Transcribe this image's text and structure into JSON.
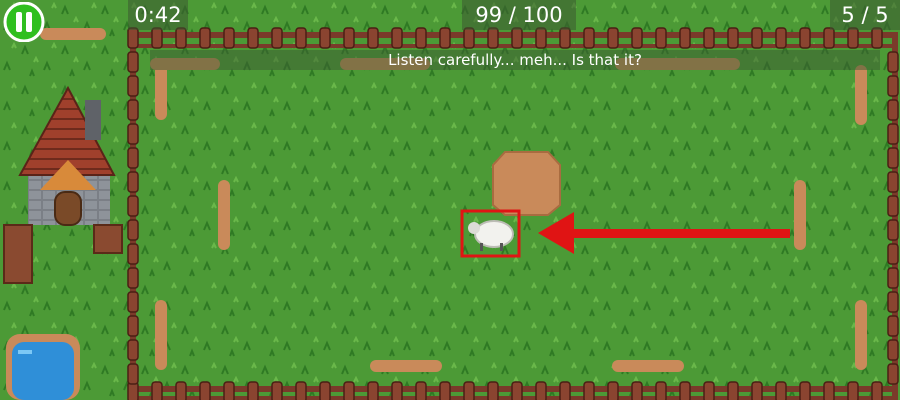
{
  "hud": {
    "timer": "0:42",
    "score": "99 / 100",
    "level": "5 / 5"
  },
  "hint": {
    "text": "Listen carefully... meh... Is that it?"
  },
  "icons": {
    "pause": "pause-icon",
    "target_marker": "target-highlight-box",
    "arrow": "left-arrow-icon"
  },
  "colors": {
    "grass": "#4c9a36",
    "fence": "#7a3a2a",
    "dirt": "#c98a5a",
    "marker": "#e01414",
    "pause_button": "#2fbf1f"
  }
}
